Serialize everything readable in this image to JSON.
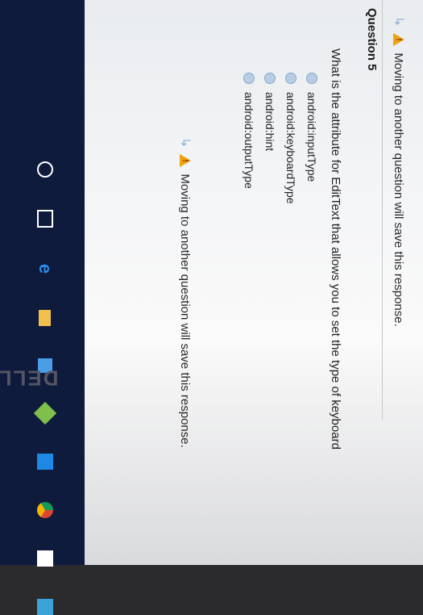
{
  "warning_top": {
    "icon": "warning-icon",
    "text": "Moving to another question will save this response."
  },
  "question": {
    "label": "Question 5",
    "text": "What is the attribute for EditText that allows you to set the type of keyboard"
  },
  "options": [
    {
      "label": "android:inputType"
    },
    {
      "label": "android:keyboardType"
    },
    {
      "label": "android:hint"
    },
    {
      "label": "android:outputType"
    }
  ],
  "warning_bottom": {
    "icon": "warning-icon",
    "text": "Moving to another question will save this response."
  },
  "taskbar": {
    "icons": [
      "search-icon",
      "task-view-icon",
      "edge-icon",
      "file-explorer-icon",
      "store-icon",
      "app-icon",
      "app-icon",
      "chrome-icon",
      "app-icon",
      "app-icon"
    ]
  },
  "brand_text": "DELL",
  "colors": {
    "warning": "#f0a30a",
    "radio": "#b7cde4",
    "taskbar": "#0f1b3d"
  }
}
